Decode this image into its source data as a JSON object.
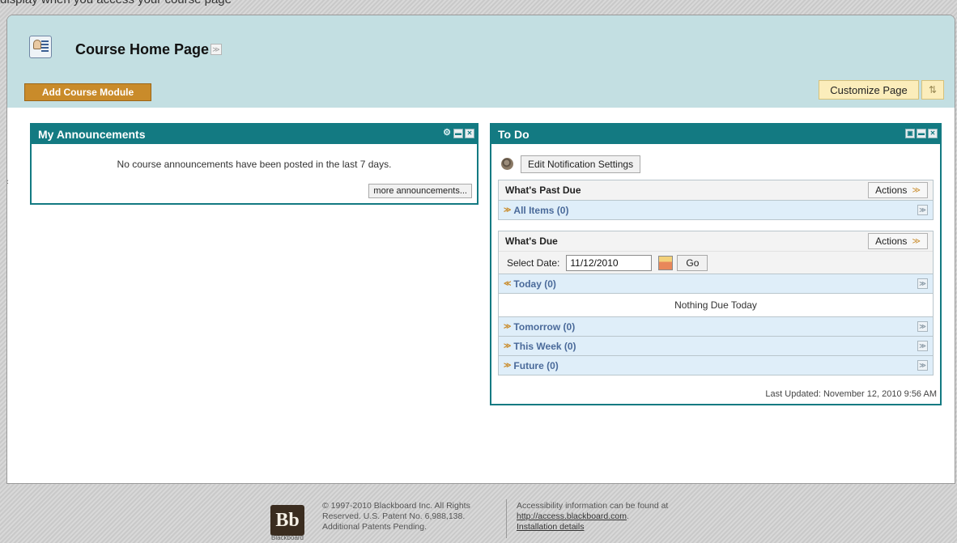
{
  "caption": "display when you access your course page",
  "header": {
    "title": "Course Home Page",
    "add_module_label": "Add Course Module",
    "customize_label": "Customize Page"
  },
  "announcements": {
    "title": "My Announcements",
    "empty_text": "No course announcements have been posted in the last 7 days.",
    "more_label": "more announcements..."
  },
  "todo": {
    "title": "To Do",
    "notification_button": "Edit Notification Settings",
    "past_due": {
      "title": "What's Past Due",
      "actions_label": "Actions",
      "rows": [
        {
          "label": "All Items (0)"
        }
      ]
    },
    "due": {
      "title": "What's Due",
      "actions_label": "Actions",
      "select_date_label": "Select Date:",
      "date_value": "11/12/2010",
      "go_label": "Go",
      "today_label": "Today (0)",
      "nothing_due": "Nothing Due Today",
      "rows": [
        {
          "label": "Tomorrow (0)"
        },
        {
          "label": "This Week (0)"
        },
        {
          "label": "Future (0)"
        }
      ]
    },
    "last_updated": "Last Updated: November 12, 2010 9:56 AM"
  },
  "footer": {
    "logo_text": "Bb",
    "logo_label": "Blackboard",
    "copyright": "© 1997-2010 Blackboard Inc. All Rights Reserved. U.S. Patent No. 6,988,138. Additional Patents Pending.",
    "access_text": "Accessibility information can be found at",
    "access_link": "http://access.blackboard.com",
    "install_link": "Installation details"
  },
  "colors": {
    "module_header": "#137a82",
    "header_bg": "#c3dfe2",
    "add_button": "#c98b2a",
    "customize_button": "#fbedbb",
    "sub_row_bg": "#dfeef9"
  }
}
